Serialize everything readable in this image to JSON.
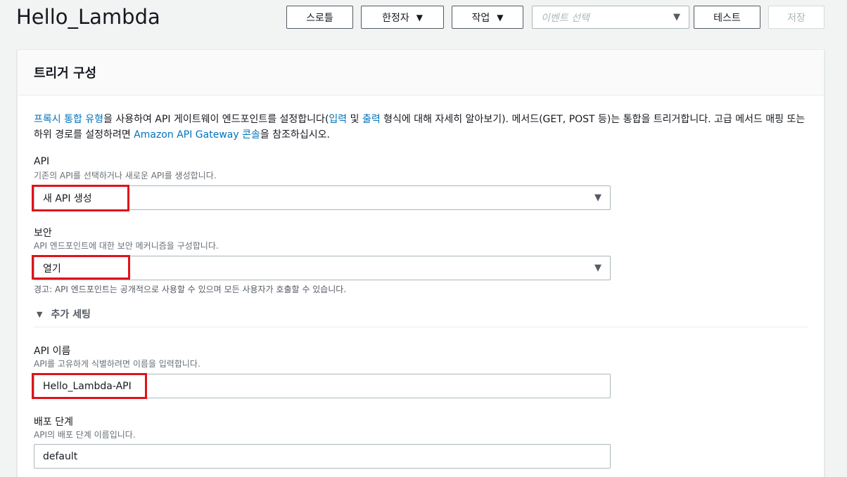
{
  "page": {
    "title": "Hello_Lambda"
  },
  "toolbar": {
    "throttle_label": "스로틀",
    "qualifier_label": "한정자",
    "actions_label": "작업",
    "event_placeholder": "이벤트 선택",
    "test_label": "테스트",
    "save_label": "저장"
  },
  "panel": {
    "title": "트리거 구성",
    "desc": {
      "link_proxy": "프록시 통합 유형",
      "t1": "을 사용하여 API 게이트웨이 엔드포인트를 설정합니다(",
      "link_input": "입력",
      "t2": " 및 ",
      "link_output": "출력",
      "t3": " 형식에 대해 자세히 알아보기). 메서드(GET, POST 등)는 통합을 트리거합니다. 고급 메서드 매핑 또는 하위 경로를 설정하려면 ",
      "link_console": "Amazon API Gateway 콘솔",
      "t4": "을 참조하십시오."
    },
    "api": {
      "label": "API",
      "hint": "기존의 API를 선택하거나 새로운 API를 생성합니다.",
      "value": "새 API 생성"
    },
    "security": {
      "label": "보안",
      "hint": "API 엔드포인트에 대한 보안 메커니즘을 구성합니다.",
      "value": "열기",
      "warning": "경고: API 엔드포인트는 공개적으로 사용할 수 있으며 모든 사용자가 호출할 수 있습니다."
    },
    "additional_settings": "추가 세팅",
    "api_name": {
      "label": "API 이름",
      "hint": "API를 고유하게 식별하려면 이름을 입력합니다.",
      "value": "Hello_Lambda-API"
    },
    "stage": {
      "label": "배포 단계",
      "hint": "API의 배포 단계 이름입니다.",
      "value": "default"
    }
  },
  "colors": {
    "link": "#0073bb",
    "highlight": "#e0121a"
  }
}
